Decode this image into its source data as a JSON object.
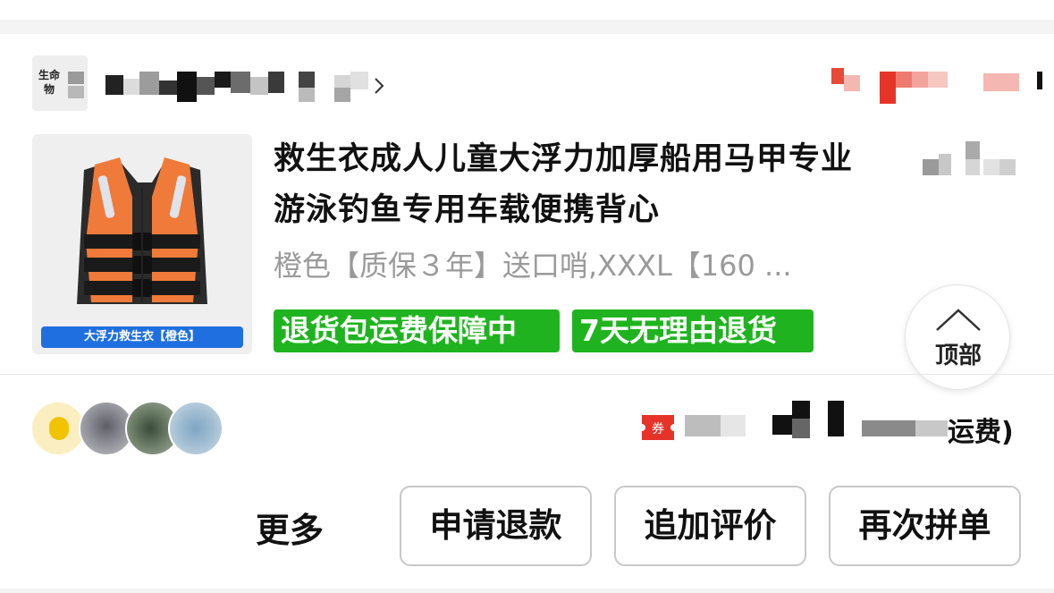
{
  "store": {
    "logo_text": "生命",
    "logo_text2": "物",
    "chevron": "chevron-right-icon"
  },
  "product": {
    "title": "救生衣成人儿童大浮力加厚船用马甲专业游泳钓鱼专用车载便携背心",
    "spec": "橙色【质保３年】送口哨,XXXL【160 ...",
    "image_caption": "大浮力救生衣【橙色】",
    "badges": [
      "退货包运费保障中",
      "7天无理由退货"
    ]
  },
  "back_to_top": {
    "label": "顶部"
  },
  "order_summary": {
    "visible_text": "运费)"
  },
  "coupon": {
    "label": "券"
  },
  "actions": {
    "more": "更多",
    "refund": "申请退款",
    "review": "追加评价",
    "rebuy": "再次拼单"
  },
  "colors": {
    "badge_green": "#1fb41f",
    "caption_blue": "#1f6fe0",
    "vest_orange": "#f07a3a",
    "coupon_red": "#e5332a"
  }
}
